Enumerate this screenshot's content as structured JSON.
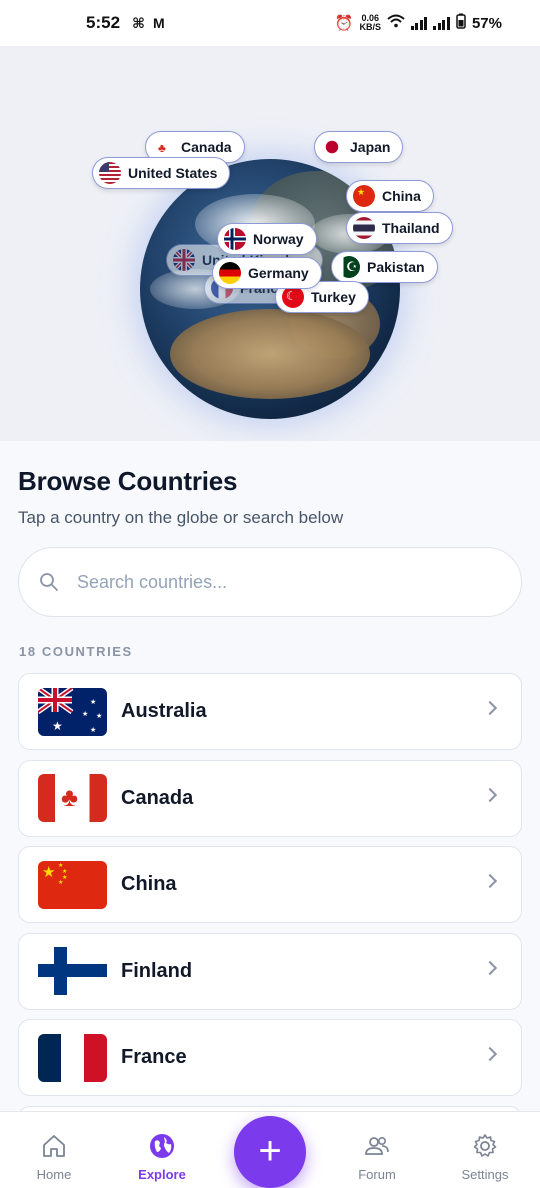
{
  "status_bar": {
    "time": "5:52",
    "net_speed_value": "0.06",
    "net_speed_unit": "KB/S",
    "battery": "57%"
  },
  "globe": {
    "labels": [
      {
        "name": "Canada",
        "flag": "canada-flag-icon"
      },
      {
        "name": "Japan",
        "flag": "japan-flag-icon"
      },
      {
        "name": "United States",
        "flag": "usa-flag-icon"
      },
      {
        "name": "China",
        "flag": "china-flag-icon"
      },
      {
        "name": "Thailand",
        "flag": "thailand-flag-icon"
      },
      {
        "name": "Norway",
        "flag": "norway-flag-icon"
      },
      {
        "name": "United Kingdom",
        "flag": "uk-flag-icon"
      },
      {
        "name": "Germany",
        "flag": "germany-flag-icon"
      },
      {
        "name": "Pakistan",
        "flag": "pakistan-flag-icon"
      },
      {
        "name": "France",
        "flag": "france-flag-icon"
      },
      {
        "name": "Turkey",
        "flag": "turkey-flag-icon"
      }
    ]
  },
  "browse": {
    "title": "Browse Countries",
    "subtitle": "Tap a country on the globe or search below",
    "search_placeholder": "Search countries...",
    "count_label": "18 COUNTRIES",
    "countries": [
      {
        "name": "Australia",
        "flag": "australia-flag-icon"
      },
      {
        "name": "Canada",
        "flag": "canada-flag-icon"
      },
      {
        "name": "China",
        "flag": "china-flag-icon"
      },
      {
        "name": "Finland",
        "flag": "finland-flag-icon"
      },
      {
        "name": "France",
        "flag": "france-flag-icon"
      }
    ]
  },
  "nav": {
    "items": [
      {
        "label": "Home",
        "icon": "home-icon"
      },
      {
        "label": "Explore",
        "icon": "globe-icon"
      },
      {
        "label": "Forum",
        "icon": "users-icon"
      },
      {
        "label": "Settings",
        "icon": "gear-icon"
      }
    ],
    "active": "Explore",
    "fab_icon": "plus-icon"
  },
  "colors": {
    "accent": "#7c3aed",
    "chip_border": "#8f9bd8",
    "background": "#f8f9fc"
  }
}
